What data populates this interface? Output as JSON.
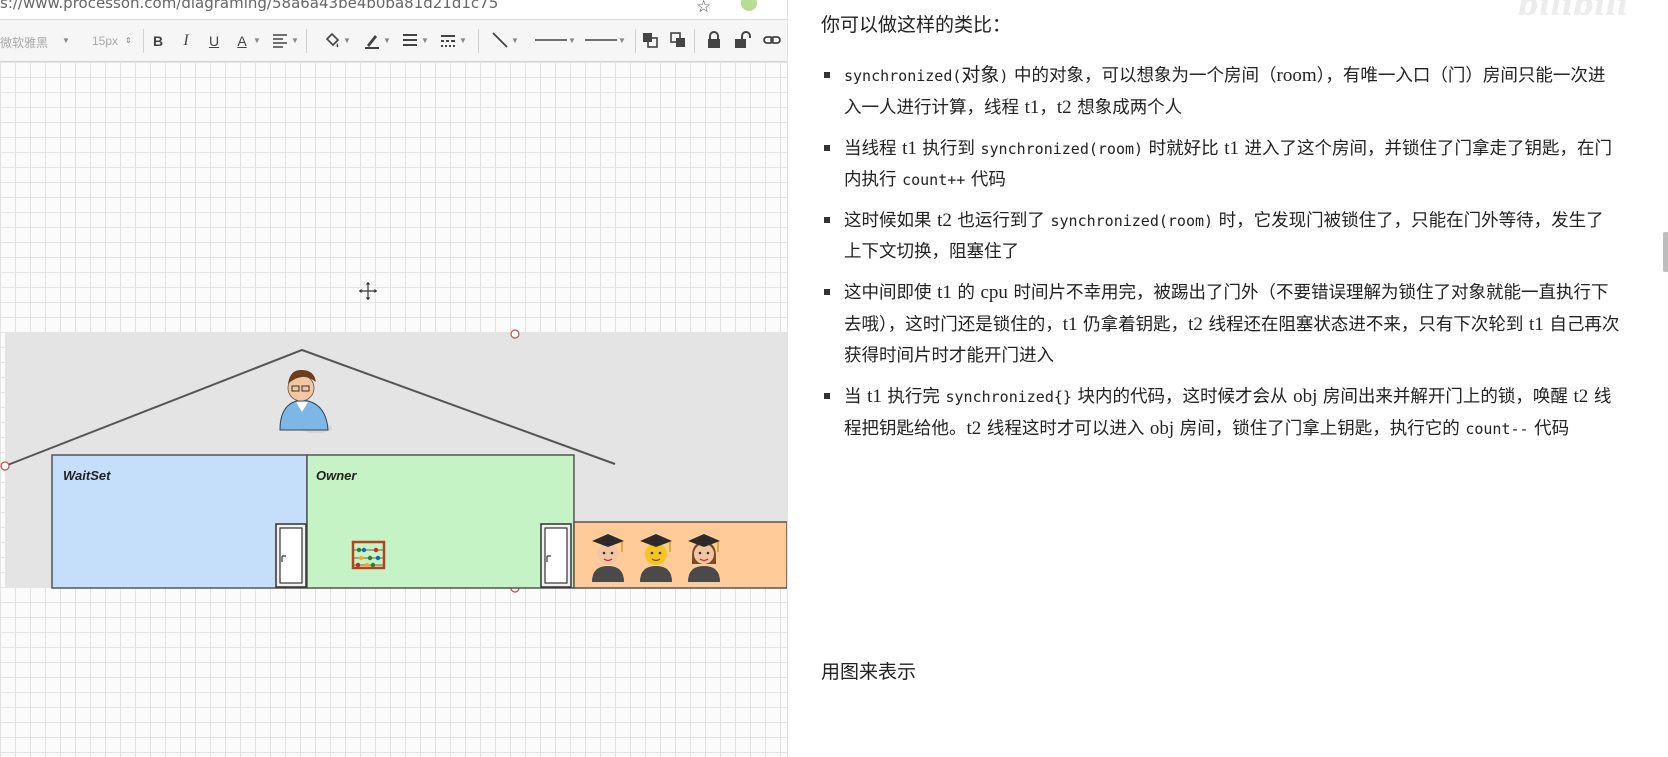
{
  "browser": {
    "url": "s://www.processon.com/diagraming/58a6a43be4b0ba81d21d1c75"
  },
  "toolbar": {
    "font_family": "微软雅黑",
    "font_size": "15px",
    "bold_label": "B",
    "italic_label": "I",
    "underline_label": "U",
    "font_color_label": "A"
  },
  "diagram": {
    "waitset_label": "WaitSet",
    "owner_label": "Owner",
    "colors": {
      "waitset": "#c5dffa",
      "owner": "#c6f3c5",
      "queue": "#ffcc99",
      "frame": "#e4e4e4"
    },
    "icons": [
      "person-icon",
      "door-icon",
      "abacus-icon",
      "student-icon"
    ]
  },
  "article": {
    "intro": "你可以做这样的类比：",
    "points": [
      {
        "p1": "synchronized(",
        "p2": "对象",
        "p3": ")",
        "p4": " 中的对象，可以想象为一个房间（",
        "p5": "room",
        "p6": "），有唯一入口（门）房间只能一次进入一人进行计算，线程 ",
        "p7": "t1",
        "p8": "，",
        "p9": "t2",
        "p10": " 想象成两个人"
      },
      {
        "p1": "当线程 ",
        "p2": "t1",
        "p3": " 执行到 ",
        "p4": "synchronized(room)",
        "p5": " 时就好比 ",
        "p6": "t1",
        "p7": " 进入了这个房间，并锁住了门拿走了钥匙，在门内执行 ",
        "p8": "count++",
        "p9": " 代码"
      },
      {
        "p1": "这时候如果 ",
        "p2": "t2",
        "p3": " 也运行到了 ",
        "p4": "synchronized(room)",
        "p5": " 时，它发现门被锁住了，只能在门外等待，发生了上下文切换，阻塞住了"
      },
      {
        "p1": "这中间即使 ",
        "p2": "t1",
        "p3": " 的 ",
        "p4": "cpu",
        "p5": " 时间片不幸用完，被踢出了门外（不要错误理解为锁住了对象就能一直执行下去哦），这时门还是锁住的，",
        "p6": "t1",
        "p7": " 仍拿着钥匙，",
        "p8": "t2",
        "p9": " 线程还在阻塞状态进不来，只有下次轮到 ",
        "p10": "t1",
        "p11": " 自己再次获得时间片时才能开门进入"
      },
      {
        "p1": "当 ",
        "p2": "t1",
        "p3": " 执行完 ",
        "p4": "synchronized{}",
        "p5": " 块内的代码，这时候才会从 ",
        "p6": "obj",
        "p7": " 房间出来并解开门上的锁，唤醒 ",
        "p8": "t2",
        "p9": " 线程把钥匙给他。",
        "p10": "t2",
        "p11": " 线程这时才可以进入 ",
        "p12": "obj",
        "p13": " 房间，锁住了门拿上钥匙，执行它的 ",
        "p14": "count--",
        "p15": " 代码"
      }
    ],
    "outro": "用图来表示"
  }
}
